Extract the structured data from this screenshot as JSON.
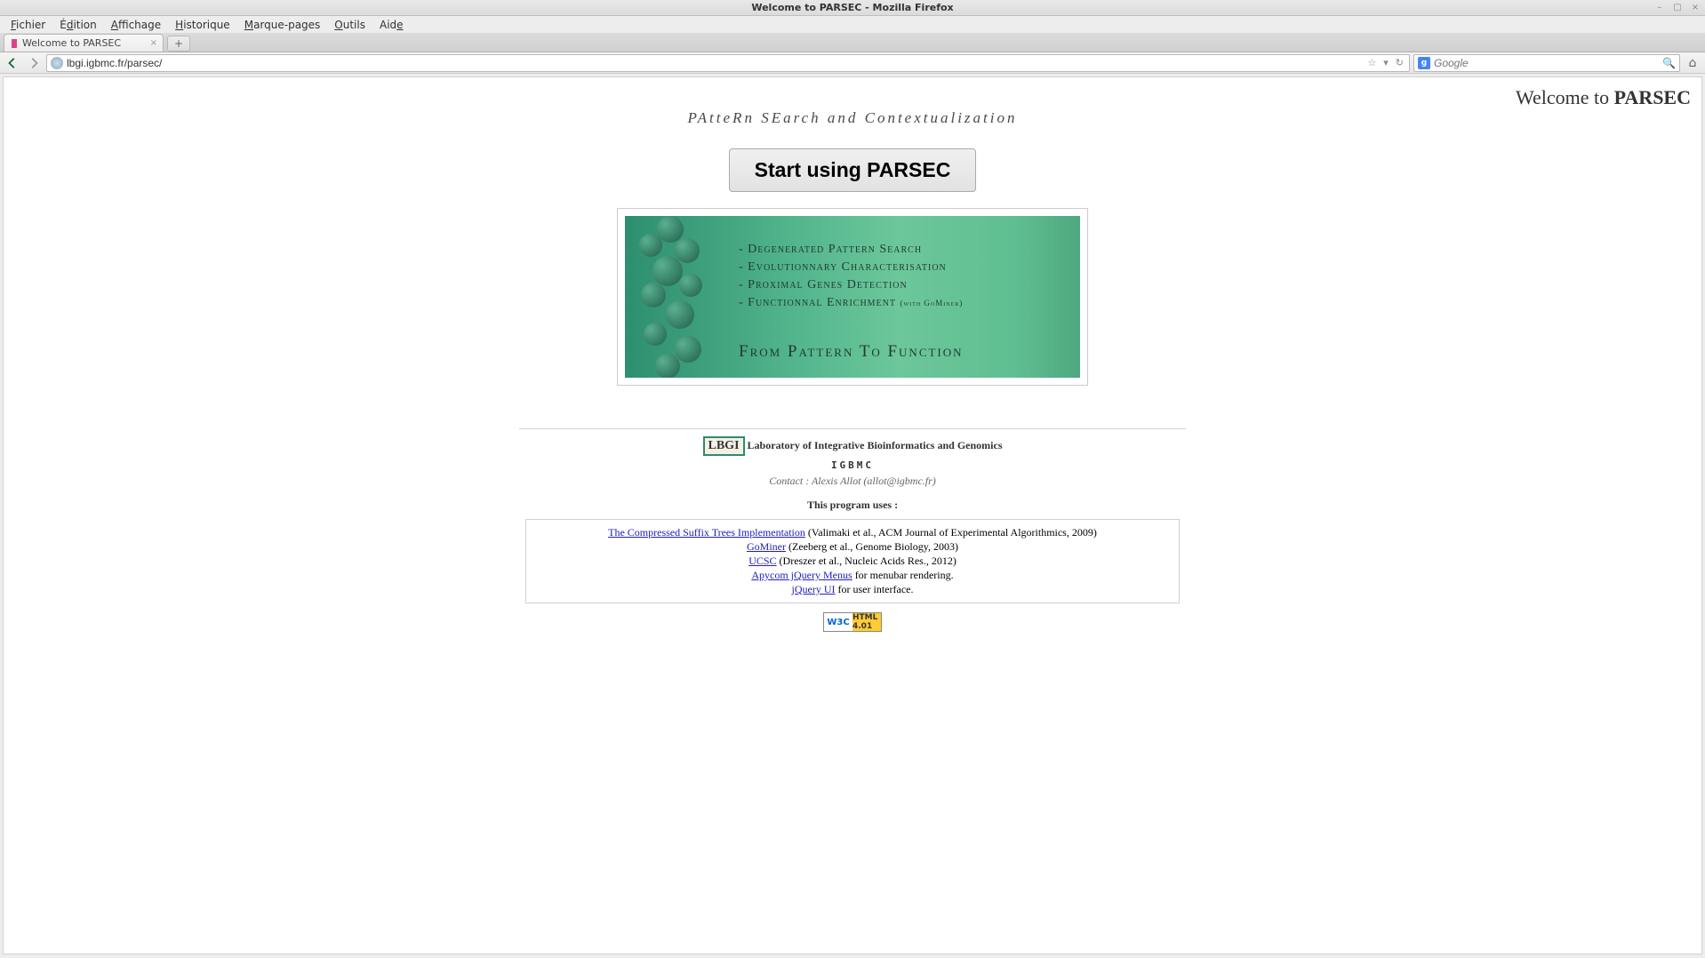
{
  "window": {
    "title": "Welcome to PARSEC - Mozilla Firefox"
  },
  "menubar": {
    "items": [
      "Fichier",
      "Édition",
      "Affichage",
      "Historique",
      "Marque-pages",
      "Outils",
      "Aide"
    ]
  },
  "tab": {
    "title": "Welcome to PARSEC"
  },
  "url": "lbgi.igbmc.fr/parsec/",
  "search": {
    "engine": "g",
    "placeholder": "Google"
  },
  "page": {
    "header_prefix": "Welcome to ",
    "header_bold": "PARSEC",
    "subtitle": "PAtteRn SEarch and Contextualization",
    "start_button": "Start using PARSEC",
    "banner": {
      "lines": [
        "Degenerated Pattern Search",
        "Evolutionnary Characterisation",
        "Proximal Genes Detection",
        "Functionnal Enrichment"
      ],
      "line4_suffix": "(with GoMiner)",
      "slogan": "From Pattern To Function"
    },
    "footer": {
      "lbgi": "LBGI",
      "lab": "Laboratory of Integrative Bioinformatics and Genomics",
      "igbmc": "IGBMC",
      "contact": "Contact : Alexis Allot (allot@igbmc.fr)",
      "uses": "This program uses :"
    },
    "refs": [
      {
        "link": "The Compressed Suffix Trees Implementation",
        "rest": " (Valimaki et al., ACM Journal of Experimental Algorithmics, 2009)"
      },
      {
        "link": "GoMiner",
        "rest": " (Zeeberg et al., Genome Biology, 2003)"
      },
      {
        "link": "UCSC",
        "rest": " (Dreszer et al., Nucleic Acids Res., 2012)"
      },
      {
        "link": "Apycom jQuery Menus",
        "rest": " for menubar rendering."
      },
      {
        "link": "jQuery UI",
        "rest": " for user interface."
      }
    ],
    "w3c": {
      "left": "W3C",
      "right": "HTML 4.01"
    }
  }
}
